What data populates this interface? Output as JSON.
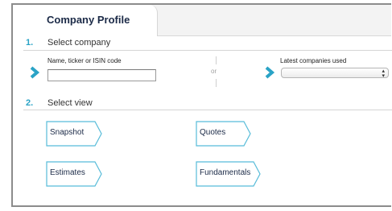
{
  "tabs": [
    {
      "label": "Company Profile",
      "active": true
    }
  ],
  "steps": [
    {
      "number": "1.",
      "title": "Select company"
    },
    {
      "number": "2.",
      "title": "Select view"
    }
  ],
  "company_search": {
    "label": "Name, ticker or ISIN code",
    "value": "",
    "placeholder": ""
  },
  "separator_text": "or",
  "latest_companies": {
    "label": "Latest companies used",
    "selected": ""
  },
  "views": [
    {
      "label": "Snapshot"
    },
    {
      "label": "Quotes"
    },
    {
      "label": "Estimates"
    },
    {
      "label": "Fundamentals"
    }
  ],
  "colors": {
    "accent": "#2aa3c6",
    "button_border": "#58bcd9",
    "title_text": "#1b2a47"
  },
  "icons": {
    "go_arrow": "chevron-right-icon",
    "dropdown": "up-down-caret-icon"
  }
}
